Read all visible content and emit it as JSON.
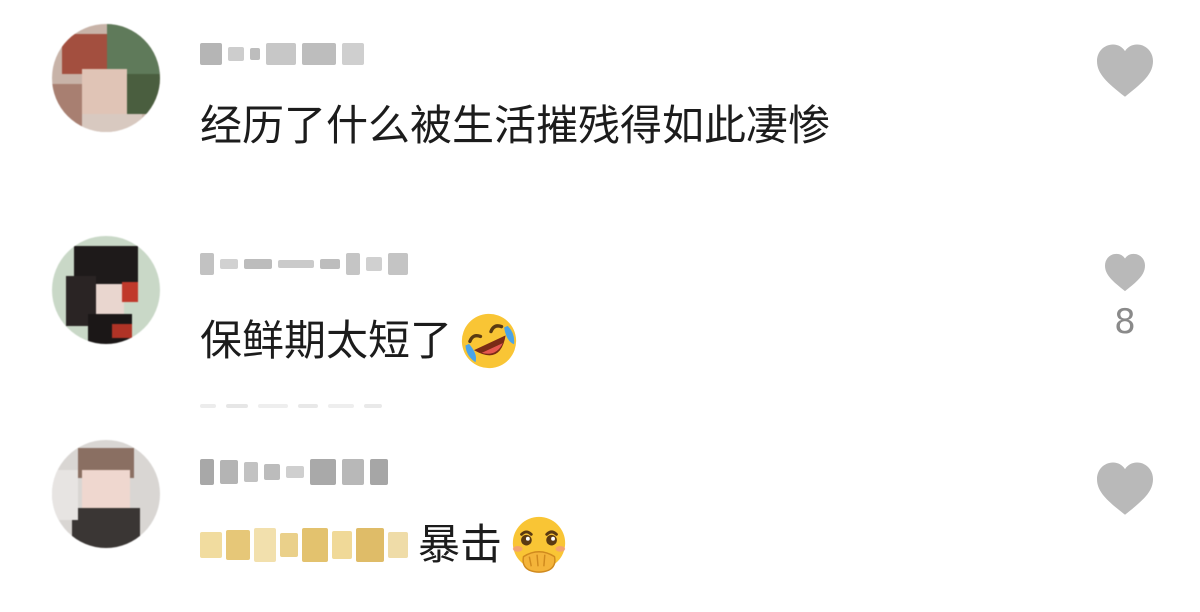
{
  "comments": [
    {
      "text": "经历了什么被生活摧残得如此凄惨",
      "like_count": ""
    },
    {
      "text": "保鲜期太短了",
      "emoji": "rolling-on-floor-laughing",
      "like_count": "8"
    },
    {
      "text": "暴击",
      "emoji": "face-with-hand-over-mouth",
      "like_count": ""
    }
  ],
  "colors": {
    "heart": "#b9b9b9",
    "text": "#1c1c1c",
    "count": "#8a8a8a"
  }
}
